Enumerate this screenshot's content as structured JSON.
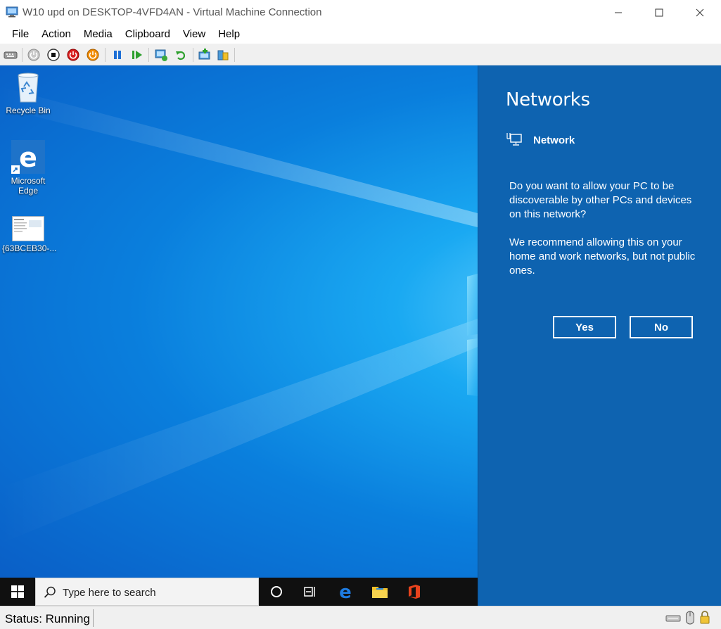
{
  "window": {
    "title": "W10 upd on DESKTOP-4VFD4AN - Virtual Machine Connection"
  },
  "menu": [
    "File",
    "Action",
    "Media",
    "Clipboard",
    "View",
    "Help"
  ],
  "toolbar": {
    "buttons": [
      "ctrl-alt-del",
      "start",
      "turn-off",
      "shut-down",
      "save",
      "pause",
      "resume",
      "checkpoint",
      "revert",
      "enhanced-session",
      "share"
    ]
  },
  "desktop": {
    "icons": [
      {
        "label": "Recycle Bin"
      },
      {
        "label": "Microsoft Edge"
      },
      {
        "label": "{63BCEB30-..."
      }
    ]
  },
  "flyout": {
    "title": "Networks",
    "network_name": "Network",
    "question": "Do you want to allow your PC to be discoverable by other PCs and devices on this network?",
    "recommendation": "We recommend allowing this on your home and work networks, but not public ones.",
    "yes_label": "Yes",
    "no_label": "No"
  },
  "taskbar": {
    "search_placeholder": "Type here to search"
  },
  "status": {
    "text": "Status: Running"
  },
  "colors": {
    "flyout_bg": "#0e63b0",
    "taskbar_bg": "#101010",
    "desktop_blue": "#0a7fdd"
  }
}
